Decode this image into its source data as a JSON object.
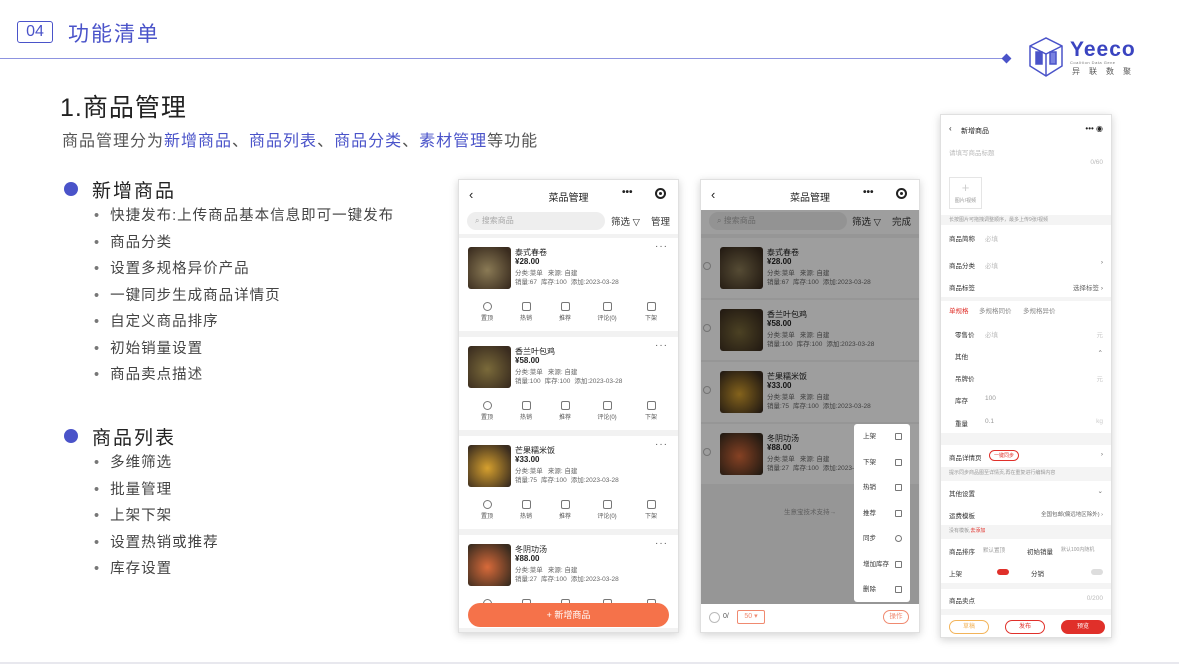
{
  "header": {
    "num": "04",
    "title": "功能清单",
    "logo": {
      "name": "Yeeco",
      "tagline": "Coalition Data Gene",
      "cn": "异联数聚"
    }
  },
  "section": {
    "title": "1.商品管理",
    "desc_prefix": "商品管理分为",
    "desc_items": [
      "新增商品",
      "商品列表",
      "商品分类",
      "素材管理"
    ],
    "desc_sep": "、",
    "desc_suffix": "等功能"
  },
  "groups": [
    {
      "title": "新增商品",
      "items": [
        "快捷发布:上传商品基本信息即可一键发布",
        "商品分类",
        "设置多规格异价产品",
        "一键同步生成商品详情页",
        "自定义商品排序",
        "初始销量设置",
        "商品卖点描述"
      ]
    },
    {
      "title": "商品列表",
      "items": [
        "多维筛选",
        "批量管理",
        "上架下架",
        "设置热销或推荐",
        "库存设置"
      ]
    }
  ],
  "phone1": {
    "title": "菜品管理",
    "search_placeholder": "搜索商品",
    "filter": "筛选",
    "manage": "管理",
    "add_button": "+ 新增商品",
    "actions": [
      "置顶",
      "热销",
      "推荐",
      "评论(0)",
      "下架"
    ]
  },
  "phone2": {
    "title": "菜品管理",
    "search_placeholder": "搜索商品",
    "filter": "筛选",
    "done": "完成",
    "footer_hint": "生意宝技术支持→",
    "bottom_count": "0/",
    "bottom_page": "50",
    "bottom_op": "操作",
    "menu": [
      "上架",
      "下架",
      "热销",
      "推荐",
      "同步",
      "增加库存",
      "删除"
    ]
  },
  "products": [
    {
      "name": "泰式春卷",
      "price": "¥28.00",
      "category": "分类:菜单",
      "source": "来源: 自建",
      "sales": "销量:67",
      "stock": "库存:100",
      "added": "添加:2023-03-28",
      "color": "#8a7a55"
    },
    {
      "name": "香兰叶包鸡",
      "price": "¥58.00",
      "category": "分类:菜单",
      "source": "来源: 自建",
      "sales": "销量:100",
      "stock": "库存:100",
      "added": "添加:2023-03-28",
      "color": "#7a6a3a"
    },
    {
      "name": "芒果糯米饭",
      "price": "¥33.00",
      "category": "分类:菜单",
      "source": "来源: 自建",
      "sales": "销量:75",
      "stock": "库存:100",
      "added": "添加:2023-03-28",
      "color": "#d6a02e"
    },
    {
      "name": "冬阴功汤",
      "price": "¥88.00",
      "category": "分类:菜单",
      "source": "来源: 自建",
      "sales": "销量:27",
      "stock": "库存:100",
      "added": "添加:2023-03-28",
      "color": "#d86a3a"
    }
  ],
  "phone3": {
    "title": "新增商品",
    "title_placeholder": "请填写商品标题",
    "title_count": "0/60",
    "image_label": "图片/视频",
    "image_hint": "长按图片可拖拽调整顺序，最多上传9张/视频",
    "short_name_label": "商品简称",
    "short_name_value": "必填",
    "category_label": "商品分类",
    "category_value": "必填",
    "tag_label": "商品标签",
    "tag_value": "选择标签",
    "spec_tabs": [
      "单规格",
      "多规格同价",
      "多规格异价"
    ],
    "sale_price_label": "零售价",
    "sale_price_value": "必填",
    "currency": "元",
    "other_label": "其他",
    "tag_price_label": "吊牌价",
    "stock_label": "库存",
    "stock_value": "100",
    "weight_label": "重量",
    "weight_value": "0.1",
    "weight_unit": "kg",
    "detail_label": "商品详情页",
    "detail_sync": "一键同步",
    "detail_hint": "提示同步商品图至详情页,再在重复进行编辑内容",
    "other_settings": "其他设置",
    "shipping_label": "运费模板",
    "shipping_value": "全国包邮(偏远地区除外)",
    "shipping_hint": "没有模板,",
    "shipping_add": "去添加",
    "sort_label": "商品排序",
    "sort_value": "默认置顶",
    "initial_sales_label": "初始销量",
    "initial_sales_value": "默认100内随机",
    "shelf_label": "上架",
    "distribution_label": "分销",
    "selling_point_label": "商品卖点",
    "selling_point_count": "0/200",
    "btn_draft": "草稿",
    "btn_publish": "发布",
    "btn_preview": "预览"
  }
}
